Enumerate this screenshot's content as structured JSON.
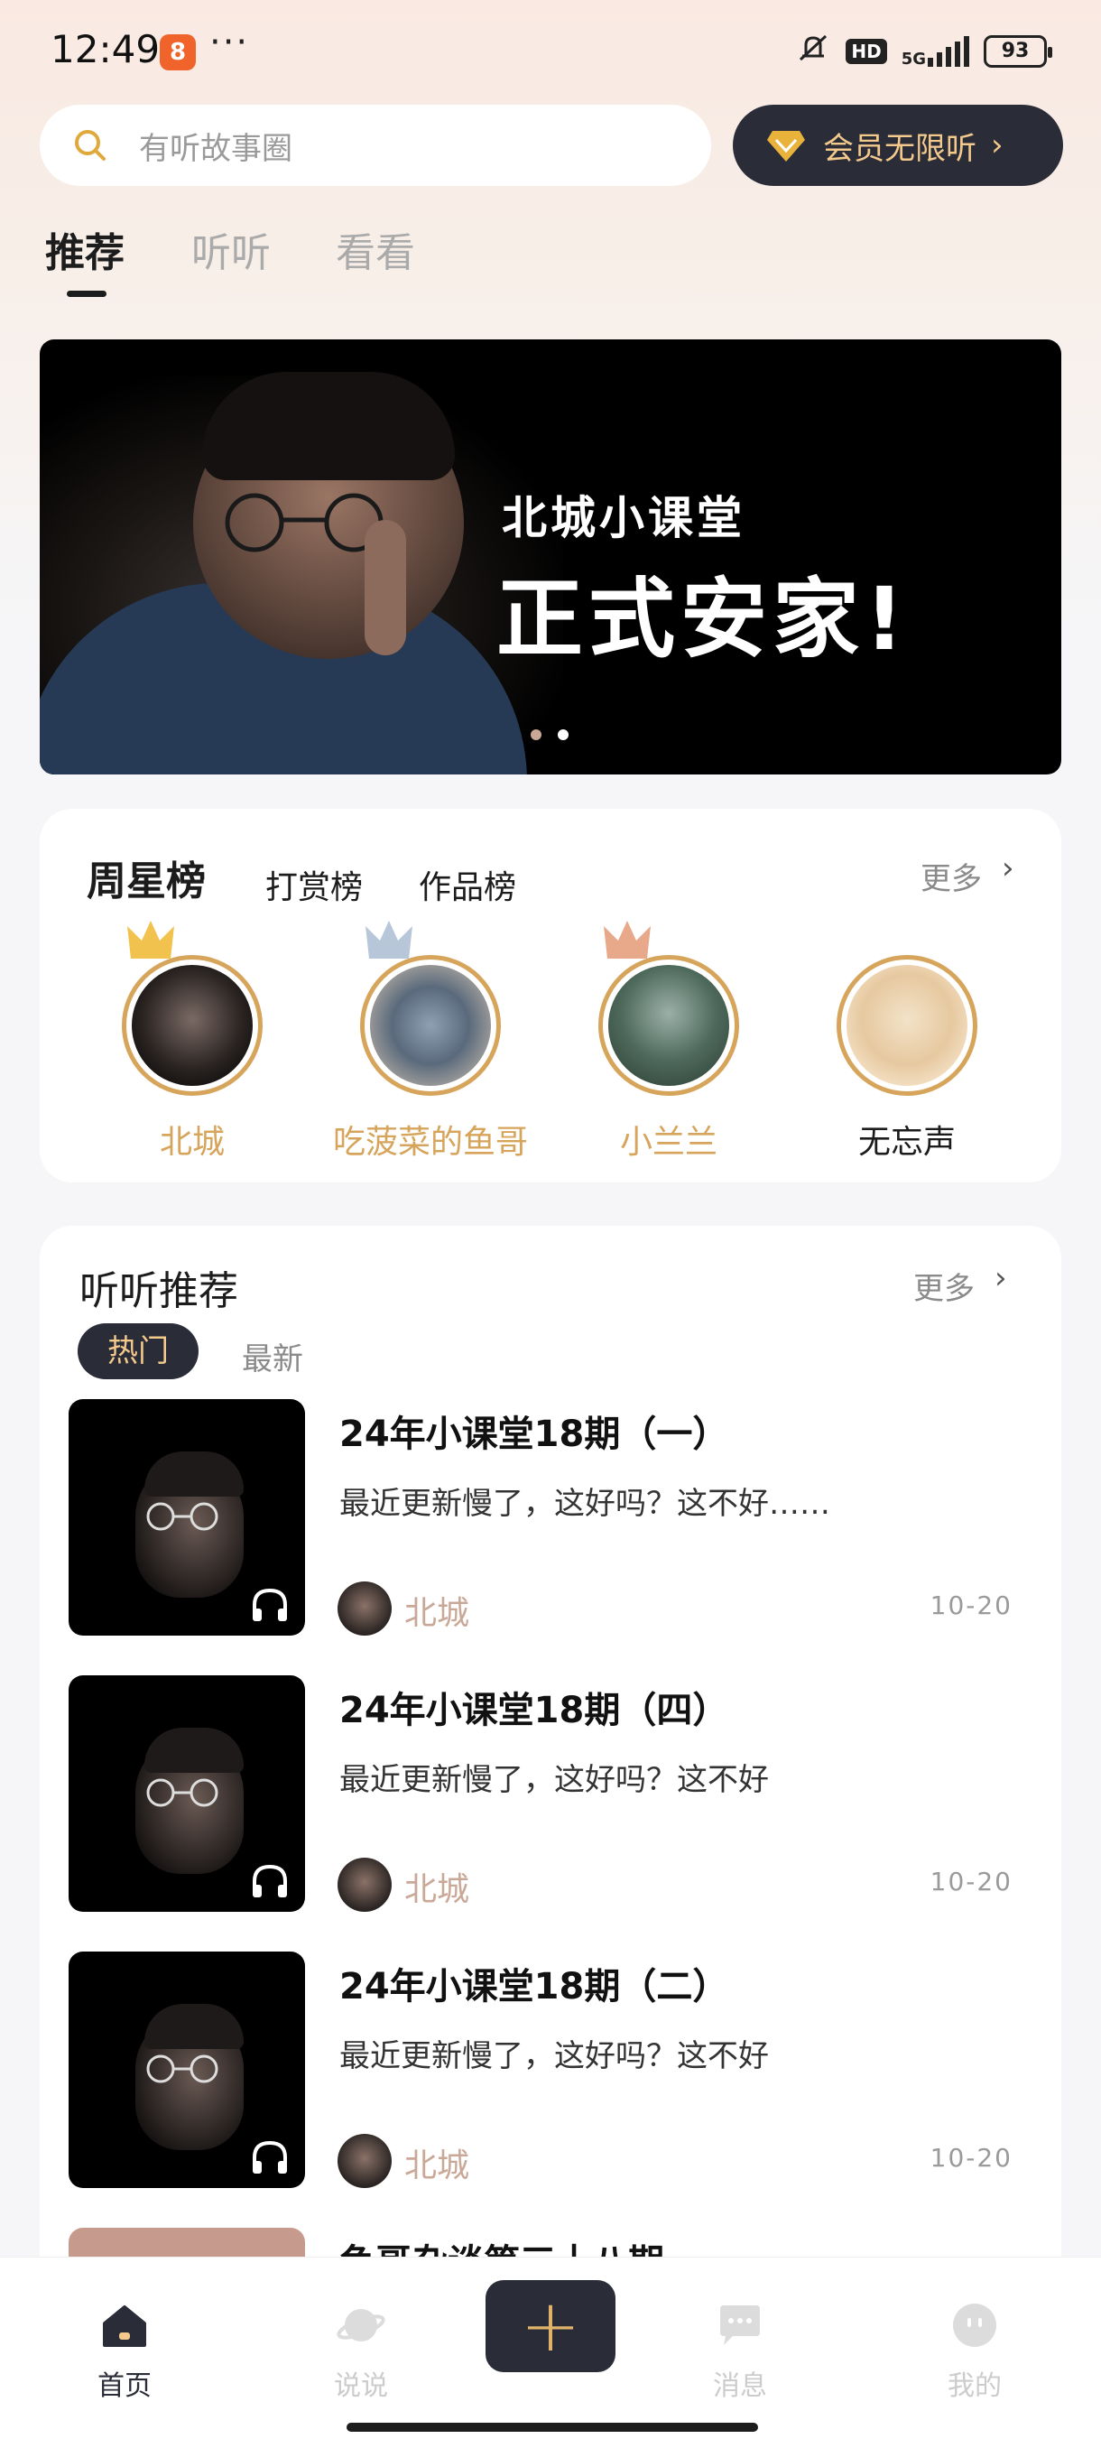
{
  "status_bar": {
    "time": "12:49",
    "app_badge": "8",
    "overflow": "···",
    "network": "5G",
    "hd": "HD",
    "battery": "93"
  },
  "search": {
    "placeholder": "有听故事圈"
  },
  "vip": {
    "label": "会员无限听",
    "chevron": "›"
  },
  "tabs": [
    {
      "label": "推荐",
      "active": true
    },
    {
      "label": "听听",
      "active": false
    },
    {
      "label": "看看",
      "active": false
    }
  ],
  "banner": {
    "title_line1": "北城小课堂",
    "title_line2": "正式安家!",
    "page_count": 2,
    "active_page": 1
  },
  "star_board": {
    "tabs": [
      "周星榜",
      "打赏榜",
      "作品榜"
    ],
    "more": "更多",
    "items": [
      {
        "name": "北城",
        "rank": 1
      },
      {
        "name": "吃菠菜的鱼哥",
        "rank": 2
      },
      {
        "name": "小兰兰",
        "rank": 3
      },
      {
        "name": "无忘声",
        "rank": 4
      }
    ],
    "colors": {
      "gold": "#d6a55b",
      "crown_1": "#f1c24d",
      "crown_2": "#b7c6d9",
      "crown_3": "#e8a98a"
    }
  },
  "recommend": {
    "title": "听听推荐",
    "more": "更多",
    "chips": {
      "hot": "热门",
      "new": "最新"
    },
    "items": [
      {
        "title": "24年小课堂18期（一）",
        "desc": "最近更新慢了，这好吗？这不好……",
        "author": "北城",
        "date": "10-20"
      },
      {
        "title": "24年小课堂18期（四）",
        "desc": "最近更新慢了，这好吗？这不好",
        "author": "北城",
        "date": "10-20"
      },
      {
        "title": "24年小课堂18期（二）",
        "desc": "最近更新慢了，这好吗？这不好",
        "author": "北城",
        "date": "10-20"
      }
    ],
    "partial_item_title": "鱼哥杂谈第三十八期"
  },
  "bottom_nav": {
    "items": [
      {
        "label": "首页",
        "icon": "home-icon",
        "active": true
      },
      {
        "label": "说说",
        "icon": "planet-icon",
        "active": false
      },
      {
        "label": "消息",
        "icon": "chat-bubble-icon",
        "active": false
      },
      {
        "label": "我的",
        "icon": "profile-icon",
        "active": false
      }
    ],
    "add": "+"
  },
  "theme": {
    "accent_dark": "#2a2c38",
    "accent_gold": "#f3c98c",
    "author_color": "#c9a897"
  }
}
